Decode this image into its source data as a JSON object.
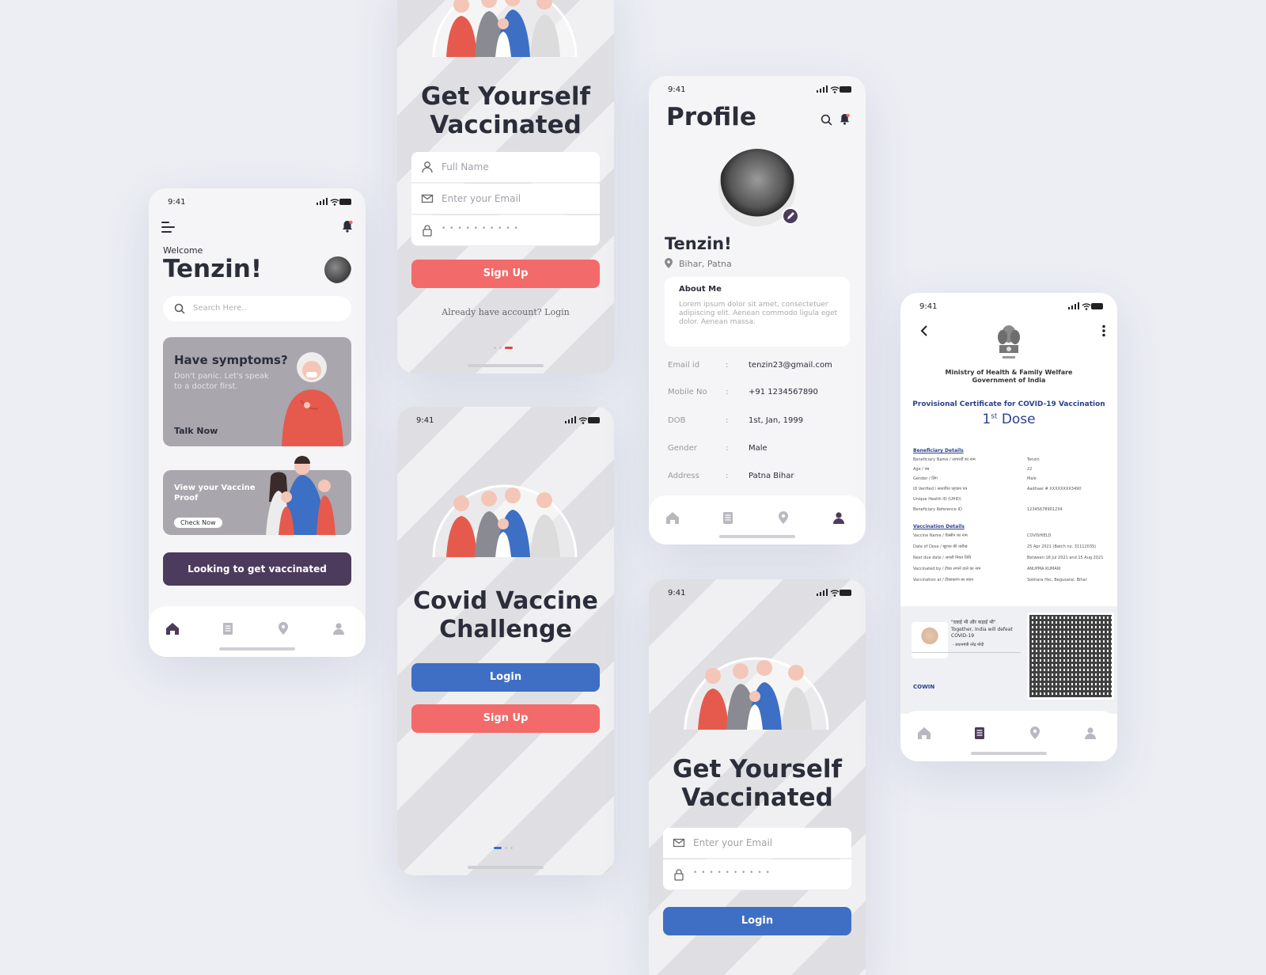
{
  "colors": {
    "accent_red": "#f26a6a",
    "accent_blue": "#3f6fc5",
    "accent_purple": "#4c3b5c",
    "text_dark": "#2b2d3a",
    "page_bg": "#eceef4"
  },
  "status": {
    "time": "9:41"
  },
  "home": {
    "welcome": "Welcome",
    "name": "Tenzin!",
    "search_placeholder": "Search Here..",
    "symptoms": {
      "title": "Have symptoms?",
      "subtitle": "Don't panic. Let's speak to a doctor first.",
      "action": "Talk Now"
    },
    "proof": {
      "title": "View your Vaccine Proof",
      "action": "Check Now"
    },
    "cta": "Looking to get vaccinated"
  },
  "signup": {
    "title": "Get Yourself Vaccinated",
    "full_name_placeholder": "Full Name",
    "email_placeholder": "Enter your Email",
    "password_mask": "• • • • • • • • • •",
    "signup_label": "Sign Up",
    "login_hint": "Already have account? Login"
  },
  "challenge": {
    "title": "Covid Vaccine Challenge",
    "login_label": "Login",
    "signup_label": "Sign Up"
  },
  "profile": {
    "title": "Profile",
    "name": "Tenzin!",
    "location": "Bihar, Patna",
    "about_title": "About Me",
    "about_text": "Lorem ipsum dolor sit amet, consectetuer adipiscing elit. Aenean commodo ligula eget dolor. Aenean massa.",
    "colon": ":",
    "fields": [
      {
        "label": "Email id",
        "value": "tenzin23@gmail.com"
      },
      {
        "label": "Mobile No",
        "value": "+91 1234567890"
      },
      {
        "label": "DOB",
        "value": "1st, Jan, 1999"
      },
      {
        "label": "Gender",
        "value": "Male"
      },
      {
        "label": "Address",
        "value": "Patna Bihar"
      }
    ]
  },
  "login": {
    "title": "Get Yourself Vaccinated",
    "email_placeholder": "Enter your Email",
    "password_mask": "• • • • • • • • • •",
    "login_label": "Login"
  },
  "certificate": {
    "ministry": "Ministry of Health & Family Welfare",
    "government": "Government of India",
    "title": "Provisional Certificate for COVID-19 Vaccination",
    "dose_num": "1",
    "dose_sup": "st",
    "dose_word": "Dose",
    "beneficiary_heading": "Beneficiary Details",
    "beneficiary_rows": [
      {
        "label": "Beneficiary Name / लाभार्थी का नाम",
        "value": "Tenzin"
      },
      {
        "label": "Age / उम्र",
        "value": "22"
      },
      {
        "label": "Gender / लिंग",
        "value": "Male"
      },
      {
        "label": "ID Verified / सत्यापित पहचान पत्र",
        "value": "Aadhaar # XXXXXXXX3490"
      },
      {
        "label": "Unique Health ID (UHID)",
        "value": ""
      },
      {
        "label": "Beneficiary Reference ID",
        "value": "12345678901234"
      }
    ],
    "vaccination_heading": "Vaccination Details",
    "vaccination_rows": [
      {
        "label": "Vaccine Name / वैक्सीन का नाम",
        "value": "COVISHIELD"
      },
      {
        "label": "Date of Dose / खुराक की तारीख",
        "value": "25 Apr 2021 (Batch no. 3111203S)"
      },
      {
        "label": "Next due date / अगली नियत तिथि",
        "value": "Between 18 Jul 2021 and 15 Aug 2021"
      },
      {
        "label": "Vaccinated by / टीका लगाने वाले का नाम",
        "value": "ANUPMA KUMARI"
      },
      {
        "label": "Vaccination at / टीकाकरण का स्थान",
        "value": "Sokhara Hsc, Begusarai, Bihar"
      }
    ],
    "quote_hindi": "\"दवाई भी और कड़ाई भी\"",
    "quote_en": "Together, India will defeat COVID-19",
    "quote_sign": "- प्रधानमंत्री नरेंद्र मोदी",
    "cowin": "COWIN"
  }
}
